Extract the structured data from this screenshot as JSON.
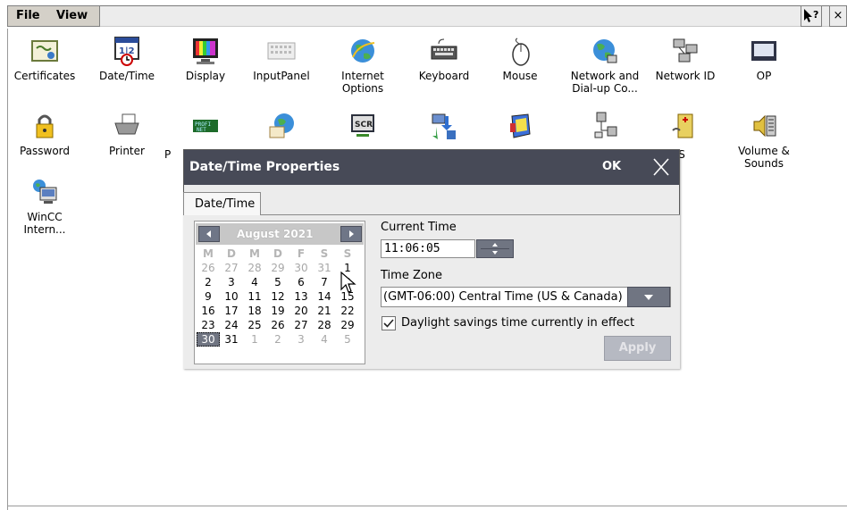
{
  "menubar": {
    "file": "File",
    "view": "View",
    "help": "?",
    "close": "×"
  },
  "control_panel": {
    "items": [
      {
        "label": "Certificates",
        "icon": "certificate-icon"
      },
      {
        "label": "Date/Time",
        "icon": "calendar-clock-icon"
      },
      {
        "label": "Display",
        "icon": "monitor-icon"
      },
      {
        "label": "InputPanel",
        "icon": "keyboard-panel-icon"
      },
      {
        "label": "Internet Options",
        "icon": "globe-icon"
      },
      {
        "label": "Keyboard",
        "icon": "keyboard-icon"
      },
      {
        "label": "Mouse",
        "icon": "mouse-icon"
      },
      {
        "label": "Network and Dial-up Co...",
        "icon": "network-globe-icon"
      },
      {
        "label": "Network ID",
        "icon": "network-computers-icon"
      },
      {
        "label": "OP",
        "icon": "operator-panel-icon"
      },
      {
        "label": "Password",
        "icon": "padlock-icon"
      },
      {
        "label": "Printer",
        "icon": "printer-icon"
      },
      {
        "label": "P",
        "icon": "profinet-icon"
      },
      {
        "label": "",
        "icon": "globe-mail-icon"
      },
      {
        "label": "",
        "icon": "screensaver-icon"
      },
      {
        "label": "",
        "icon": "transfer-icon"
      },
      {
        "label": "",
        "icon": "book-icon"
      },
      {
        "label": "",
        "icon": "network-settings-icon"
      },
      {
        "label": "PS",
        "icon": "ups-icon"
      },
      {
        "label": "Volume & Sounds",
        "icon": "speaker-icon"
      },
      {
        "label": "WinCC Intern...",
        "icon": "wincc-internet-icon"
      }
    ]
  },
  "dialog": {
    "title": "Date/Time Properties",
    "ok": "OK",
    "tab": "Date/Time",
    "calendar": {
      "month_title": "August 2021",
      "weekdays": [
        "M",
        "D",
        "M",
        "D",
        "F",
        "S",
        "S"
      ],
      "weeks": [
        [
          "26",
          "27",
          "28",
          "29",
          "30",
          "31",
          "1"
        ],
        [
          "2",
          "3",
          "4",
          "5",
          "6",
          "7",
          "8"
        ],
        [
          "9",
          "10",
          "11",
          "12",
          "13",
          "14",
          "15"
        ],
        [
          "16",
          "17",
          "18",
          "19",
          "20",
          "21",
          "22"
        ],
        [
          "23",
          "24",
          "25",
          "26",
          "27",
          "28",
          "29"
        ],
        [
          "30",
          "31",
          "1",
          "2",
          "3",
          "4",
          "5"
        ]
      ],
      "selected": "30"
    },
    "current_time_label": "Current Time",
    "current_time_value": "11:06:05",
    "time_zone_label": "Time Zone",
    "time_zone_value": "(GMT-06:00) Central Time (US & Canada)",
    "dst_label": "Daylight savings time currently in effect",
    "dst_checked": true,
    "apply": "Apply"
  },
  "colors": {
    "title_bar": "#474a57",
    "button_dark": "#707582",
    "dialog_bg": "#ececec"
  }
}
